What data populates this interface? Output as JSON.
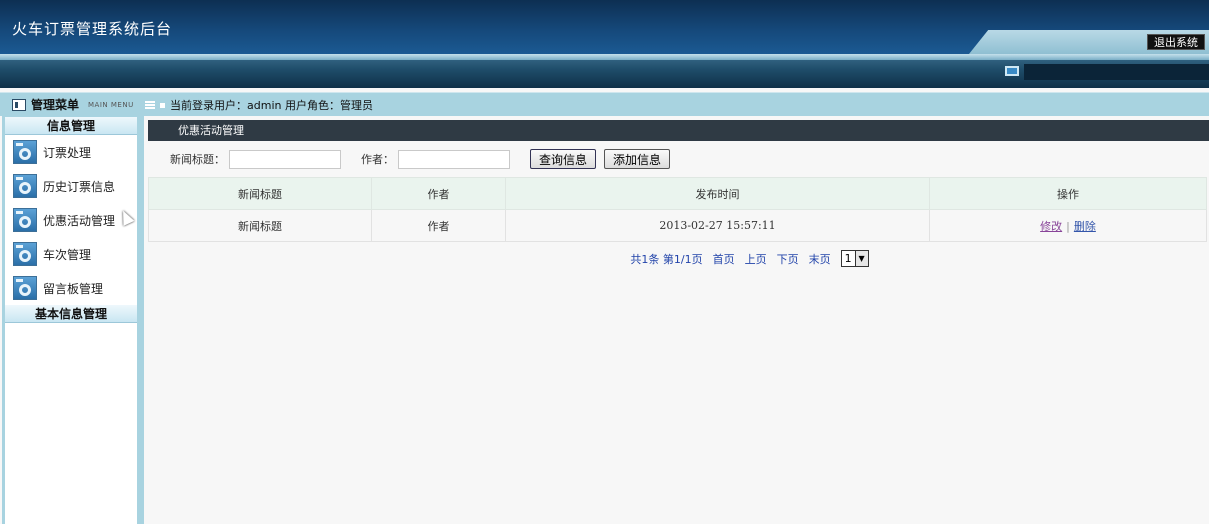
{
  "header": {
    "app_title": "火车订票管理系统后台",
    "logout_label": "退出系统"
  },
  "info_bar": {
    "menu_title": "管理菜单",
    "menu_subtitle": "MAIN MENU",
    "login_text": "当前登录用户：admin 用户角色：管理员"
  },
  "sidebar": {
    "groups": [
      {
        "title": "信息管理",
        "items": [
          {
            "label": "订票处理"
          },
          {
            "label": "历史订票信息"
          },
          {
            "label": "优惠活动管理"
          },
          {
            "label": "车次管理"
          },
          {
            "label": "留言板管理"
          }
        ]
      },
      {
        "title": "基本信息管理",
        "items": []
      }
    ]
  },
  "main": {
    "panel_title": "优惠活动管理",
    "search": {
      "title_label": "新闻标题：",
      "title_value": "",
      "author_label": "作者：",
      "author_value": "",
      "query_button": "查询信息",
      "add_button": "添加信息"
    },
    "table": {
      "columns": [
        "新闻标题",
        "作者",
        "发布时间",
        "操作"
      ],
      "rows": [
        {
          "title": "新闻标题",
          "author": "作者",
          "time": "2013-02-27 15:57:11",
          "edit": "修改",
          "delete": "删除"
        }
      ]
    },
    "pager": {
      "total": "共1条",
      "page_info": "第1/1页",
      "first": "首页",
      "prev": "上页",
      "next": "下页",
      "last": "末页",
      "current": "1"
    }
  },
  "colors": {
    "banner": "#15487a",
    "sidebar_bg": "#a8d3e0",
    "panel_title_bg": "#2f3a44",
    "link": "#3355aa"
  }
}
